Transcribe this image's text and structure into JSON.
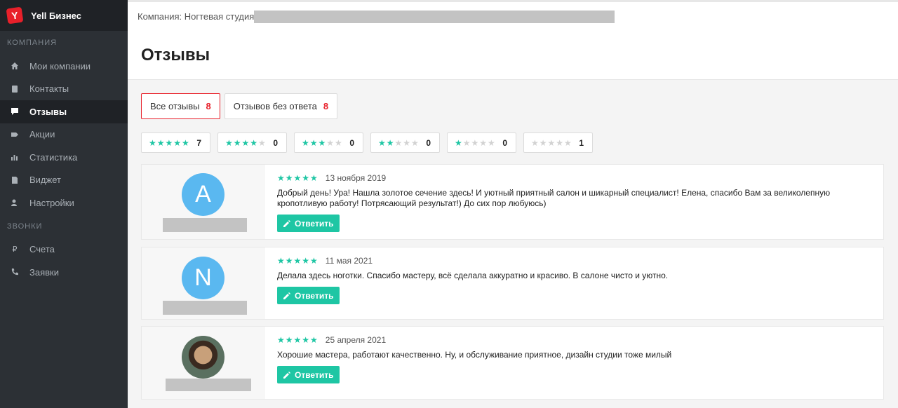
{
  "brand": {
    "logo": "Y",
    "name": "Yell Бизнес"
  },
  "sidebar": {
    "section_company": "Компания",
    "section_calls": "Звонки",
    "items": [
      {
        "label": "Мои компании",
        "icon": "home-icon"
      },
      {
        "label": "Контакты",
        "icon": "contacts-icon"
      },
      {
        "label": "Отзывы",
        "icon": "comment-icon",
        "active": true
      },
      {
        "label": "Акции",
        "icon": "tag-icon"
      },
      {
        "label": "Статистика",
        "icon": "chart-icon"
      },
      {
        "label": "Виджет",
        "icon": "widget-icon"
      },
      {
        "label": "Настройки",
        "icon": "settings-icon"
      }
    ],
    "calls_items": [
      {
        "label": "Счета",
        "icon": "ruble-icon"
      },
      {
        "label": "Заявки",
        "icon": "phone-icon"
      }
    ]
  },
  "topbar": {
    "company_label": "Компания: Ногтевая студия"
  },
  "page": {
    "title": "Отзывы"
  },
  "tabs": [
    {
      "label": "Все отзывы",
      "count": "8",
      "active": true
    },
    {
      "label": "Отзывов без ответа",
      "count": "8",
      "active": false
    }
  ],
  "rating_filters": [
    {
      "stars": 5,
      "count": "7"
    },
    {
      "stars": 4,
      "count": "0"
    },
    {
      "stars": 3,
      "count": "0"
    },
    {
      "stars": 2,
      "count": "0"
    },
    {
      "stars": 1,
      "count": "0"
    },
    {
      "stars": 0,
      "count": "1"
    }
  ],
  "reviews": [
    {
      "avatar_letter": "A",
      "stars": "★★★★★",
      "date": "13 ноября 2019",
      "text": "Добрый день! Ура! Нашла золотое сечение здесь! И уютный приятный салон и шикарный специалист! Елена, спасибо Вам за великолепную кропотливую работу! Потрясающий результат!) До сих пор любуюсь)",
      "reply_label": "Ответить"
    },
    {
      "avatar_letter": "N",
      "stars": "★★★★★",
      "date": "11 мая 2021",
      "text": "Делала здесь ноготки. Спасибо мастеру, всё сделала аккуратно и красиво. В салоне чисто и уютно.",
      "reply_label": "Ответить"
    },
    {
      "avatar_letter": "",
      "stars": "★★★★★",
      "date": "25 апреля 2021",
      "text": "Хорошие мастера, работают качественно. Ну, и обслуживание приятное, дизайн студии тоже милый",
      "reply_label": "Ответить"
    }
  ],
  "colors": {
    "accent_red": "#e8202a",
    "accent_green": "#1ec6a4",
    "sidebar_bg": "#2c3035"
  }
}
